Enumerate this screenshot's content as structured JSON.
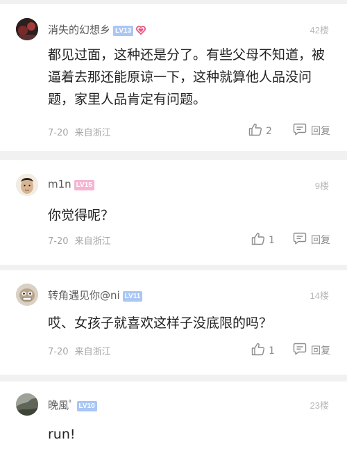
{
  "comments": [
    {
      "username": "消失的幻想乡",
      "level": "LV13",
      "floor": "42楼",
      "text": "都见过面，这种还是分了。有些父母不知道，被逼着去那还能原谅一下，这种就算他人品没问题，家里人品肯定有问题。",
      "date": "7-20",
      "location": "来自浙江",
      "likes": "2",
      "reply_label": "回复"
    },
    {
      "username": "m1n",
      "level": "LV15",
      "floor": "9楼",
      "text": "你觉得呢？",
      "date": "7-20",
      "location": "来自浙江",
      "likes": "1",
      "reply_label": "回复"
    },
    {
      "username": "转角遇见你@ni",
      "level": "LV11",
      "floor": "14楼",
      "text": "哎、女孩子就喜欢这样子没底限的吗？",
      "date": "7-20",
      "location": "来自浙江",
      "likes": "1",
      "reply_label": "回复"
    },
    {
      "username": "晚風ﾟ",
      "level": "LV10",
      "floor": "23楼",
      "text": "run!"
    }
  ],
  "colors": {
    "level_blue": "#a9c6f5",
    "level_pink": "#f6b4d3",
    "heart": "#e8567f",
    "page_bg": "#f1f1f1"
  },
  "icons": [
    "heart-icon",
    "thumbs-up-icon",
    "reply-icon"
  ]
}
